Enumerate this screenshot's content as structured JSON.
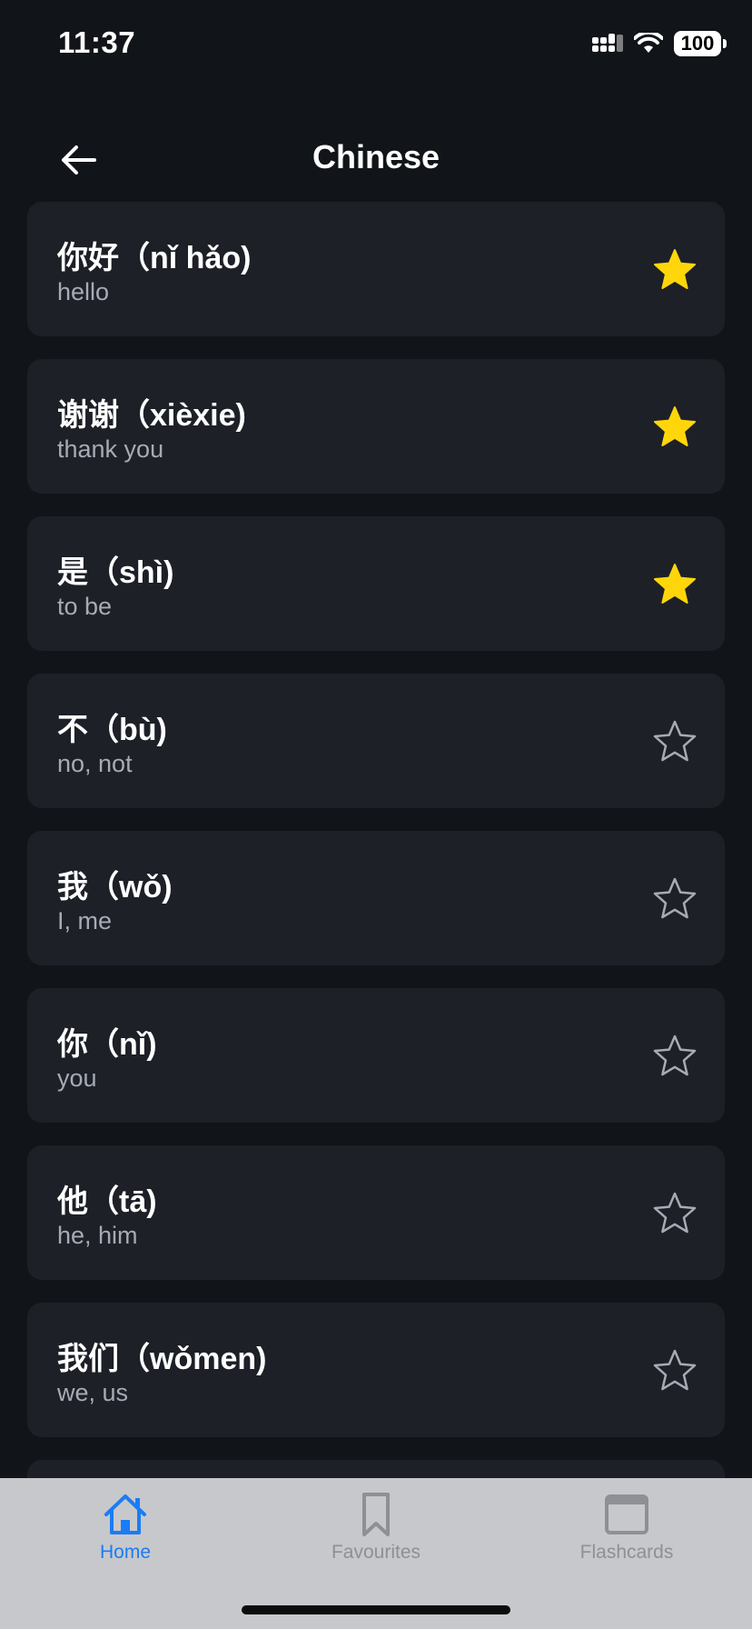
{
  "status_bar": {
    "time": "11:37",
    "battery": "100"
  },
  "header": {
    "title": "Chinese"
  },
  "words": [
    {
      "term": "你好（nǐ hǎo)",
      "meaning": "hello",
      "favourite": true
    },
    {
      "term": "谢谢（xièxie)",
      "meaning": "thank you",
      "favourite": true
    },
    {
      "term": "是（shì)",
      "meaning": "to be",
      "favourite": true
    },
    {
      "term": "不（bù)",
      "meaning": "no, not",
      "favourite": false
    },
    {
      "term": "我（wǒ)",
      "meaning": "I, me",
      "favourite": false
    },
    {
      "term": "你（nǐ)",
      "meaning": "you",
      "favourite": false
    },
    {
      "term": "他（tā)",
      "meaning": "he, him",
      "favourite": false
    },
    {
      "term": "我们（wǒmen)",
      "meaning": "we, us",
      "favourite": false
    },
    {
      "term": "",
      "meaning": "",
      "favourite": false
    }
  ],
  "tabs": [
    {
      "label": "Home",
      "icon": "house-icon",
      "active": true
    },
    {
      "label": "Favourites",
      "icon": "bookmark-icon",
      "active": false
    },
    {
      "label": "Flashcards",
      "icon": "flashcards-icon",
      "active": false
    }
  ],
  "colors": {
    "background": "#111418",
    "card": "#1d2027",
    "star_filled": "#ffd60a",
    "star_outline": "#a6abb5",
    "accent": "#1a7cf5",
    "tab_bar": "#c7c8cb"
  }
}
